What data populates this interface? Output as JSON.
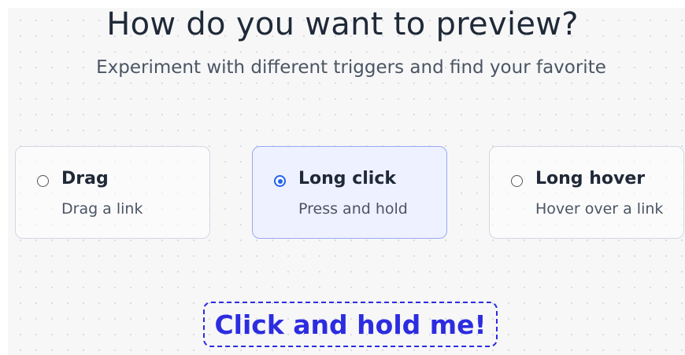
{
  "header": {
    "title": "How do you want to preview?",
    "subtitle": "Experiment with different triggers and find your favorite"
  },
  "options": [
    {
      "title": "Drag",
      "description": "Drag a link",
      "selected": false
    },
    {
      "title": "Long click",
      "description": "Press and hold",
      "selected": true
    },
    {
      "title": "Long hover",
      "description": "Hover over a link",
      "selected": false
    }
  ],
  "demo": {
    "label": "Click and hold me!"
  },
  "colors": {
    "accent": "#2c2ce0",
    "radio_checked": "#2563eb",
    "selected_card_bg": "#eef1ff",
    "title_text": "#1f2937"
  }
}
